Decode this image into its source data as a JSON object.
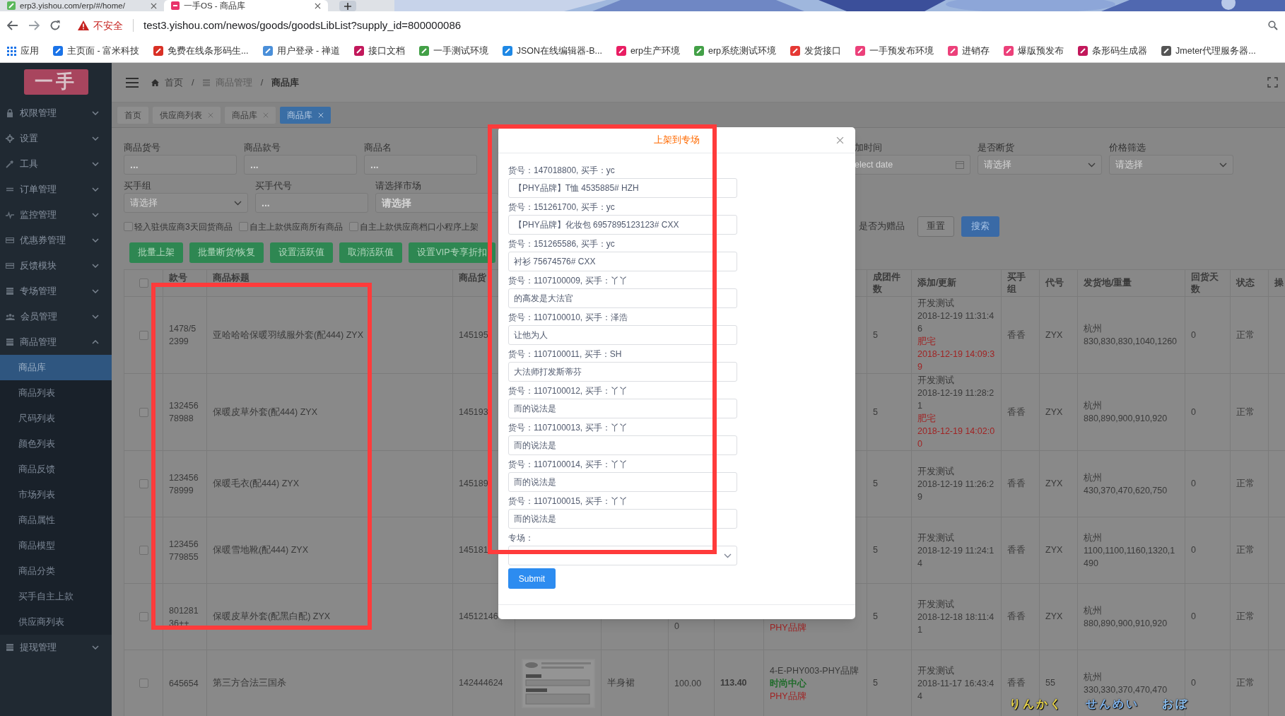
{
  "browser": {
    "tabs": [
      {
        "title": "erp3.yishou.com/erp/#/home/",
        "selected": false
      },
      {
        "title": "一手OS - 商品库",
        "selected": true
      }
    ],
    "security": "不安全",
    "url": "test3.yishou.com/newos/goods/goodsLibList?supply_id=800000086",
    "bookmarks": [
      "应用",
      "主页面 - 富米科技",
      "免费在线条形码生...",
      "用户登录 - 禅道",
      "接口文档",
      "一手测试环境",
      "JSON在线编辑器-B...",
      "erp生产环境",
      "erp系统测试环境",
      "发货接口",
      "一手预发布环境",
      "进销存",
      "爆版预发布",
      "条形码生成器",
      "Jmeter代理服务器..."
    ]
  },
  "sidebar": {
    "logo": "一手",
    "items": [
      {
        "label": "权限管理",
        "expanded": false
      },
      {
        "label": "设置",
        "expanded": false
      },
      {
        "label": "工具",
        "expanded": false
      },
      {
        "label": "订单管理",
        "expanded": false
      },
      {
        "label": "监控管理",
        "expanded": false
      },
      {
        "label": "优惠券管理",
        "expanded": false
      },
      {
        "label": "反馈模块",
        "expanded": false
      },
      {
        "label": "专场管理",
        "expanded": false
      },
      {
        "label": "会员管理",
        "expanded": false
      },
      {
        "label": "商品管理",
        "expanded": true,
        "children": [
          {
            "label": "商品库",
            "selected": true
          },
          {
            "label": "商品列表",
            "selected": false
          },
          {
            "label": "尺码列表",
            "selected": false
          },
          {
            "label": "颜色列表",
            "selected": false
          },
          {
            "label": "商品反馈",
            "selected": false
          },
          {
            "label": "市场列表",
            "selected": false
          },
          {
            "label": "商品属性",
            "selected": false
          },
          {
            "label": "商品模型",
            "selected": false
          },
          {
            "label": "商品分类",
            "selected": false
          },
          {
            "label": "买手自主上款",
            "selected": false
          },
          {
            "label": "供应商列表",
            "selected": false
          }
        ]
      },
      {
        "label": "提现管理",
        "expanded": false
      }
    ]
  },
  "breadcrumb": [
    {
      "kind": "home",
      "label": "首页"
    },
    {
      "kind": "separator",
      "label": "/"
    },
    {
      "kind": "section",
      "label": "商品管理"
    },
    {
      "kind": "separator",
      "label": "/"
    },
    {
      "kind": "current",
      "label": "商品库"
    }
  ],
  "tags": [
    {
      "label": "首页",
      "closable": false,
      "selected": false
    },
    {
      "label": "供应商列表",
      "closable": true,
      "selected": false
    },
    {
      "label": "商品库",
      "closable": true,
      "selected": false
    },
    {
      "label": "商品库",
      "closable": true,
      "selected": true
    }
  ],
  "filters": {
    "row_1_left": [
      {
        "label": "商品货号",
        "kind": "input",
        "placeholder": "..."
      },
      {
        "label": "商品款号",
        "kind": "input",
        "placeholder": "..."
      },
      {
        "label": "商品名",
        "kind": "input",
        "placeholder": "..."
      }
    ],
    "row_1_right": [
      {
        "label": "加时间",
        "kind": "date",
        "placeholder": "elect date"
      },
      {
        "label": "是否断货",
        "kind": "select",
        "placeholder": "请选择"
      },
      {
        "label": "价格筛选",
        "kind": "select",
        "placeholder": "请选择"
      }
    ],
    "row_2": [
      {
        "label": "买手组",
        "kind": "select",
        "placeholder": "请选择"
      },
      {
        "label": "买手代号",
        "kind": "input",
        "placeholder": "..."
      },
      {
        "label": "请选择市场",
        "kind": "input",
        "placeholder": "请选择"
      }
    ],
    "options": [
      {
        "label": "轻入驻供应商3天回货商品",
        "checked": false
      },
      {
        "label": "自主上款供应商所有商品",
        "checked": false
      },
      {
        "label": "自主上款供应商档口小程序上架",
        "checked": false
      }
    ],
    "gift_option": "是否为赠品",
    "reset": "重置",
    "search": "搜索"
  },
  "actions": [
    "批量上架",
    "批量断货/恢复",
    "设置活跃值",
    "取消活跃值",
    "设置VIP专享折扣"
  ],
  "table": {
    "header_checked": false,
    "columns_left": [
      "款号",
      "商品标题",
      "商品货"
    ],
    "columns_right": [
      "成团件数",
      "添加/更新",
      "买手组",
      "代号",
      "发货地/重量",
      "回货天数",
      "状态",
      "操"
    ],
    "rows": [
      {
        "checked": false,
        "style_no": "1478/52399",
        "title": "亚哈哈哈保暖羽绒服外套(配444) ZYX",
        "goods_no": "145195",
        "group_size": "5",
        "creator": "开发测试",
        "created": "2018-12-19 11:31:46",
        "updater": "肥宅",
        "updated": "2018-12-19 14:09:39",
        "buyer_group": "香香",
        "code": "ZYX",
        "origin": "杭州",
        "weights": "830,830,830,1040,1260",
        "return_days": "0",
        "status": "正常"
      },
      {
        "checked": false,
        "style_no": "13245678988",
        "title": "保暖皮草外套(配444) ZYX",
        "goods_no": "145193",
        "group_size": "5",
        "creator": "开发测试",
        "created": "2018-12-19 11:28:21",
        "updater": "肥宅",
        "updated": "2018-12-19 14:02:00",
        "buyer_group": "香香",
        "code": "ZYX",
        "origin": "杭州",
        "weights": "880,890,900,910,920",
        "return_days": "0",
        "status": "正常"
      },
      {
        "checked": false,
        "style_no": "12345678999",
        "title": "保暖毛衣(配444) ZYX",
        "goods_no": "145189",
        "group_size": "5",
        "creator": "开发测试",
        "created": "2018-12-19 11:26:29",
        "buyer_group": "香香",
        "code": "ZYX",
        "origin": "杭州",
        "weights": "430,370,470,620,750",
        "return_days": "0",
        "status": "正常"
      },
      {
        "checked": false,
        "style_no": "123456779855",
        "title": "保暖雪地靴(配444) ZYX",
        "goods_no": "145181",
        "group_size": "5",
        "creator": "开发测试",
        "created": "2018-12-19 11:24:14",
        "buyer_group": "香香",
        "code": "ZYX",
        "origin": "杭州",
        "weights": "1100,1100,1160,1320,1490",
        "return_days": "0",
        "status": "正常"
      },
      {
        "checked": false,
        "style_no": "80128136++",
        "title": "保暖皮草外套(配黑白配) ZYX",
        "goods_no": "14512146",
        "price": "0",
        "tags": [
          {
            "kind": "brand",
            "text": "PHY品牌"
          }
        ],
        "group_size": "5",
        "creator": "开发测试",
        "created": "2018-12-18 18:11:41",
        "buyer_group": "香香",
        "code": "ZYX",
        "origin": "杭州",
        "weights": "880,890,900,910,920",
        "return_days": "0",
        "status": "正常"
      },
      {
        "checked": false,
        "style_no": "645654",
        "title": "第三方合法三国杀",
        "goods_no": "142444624",
        "image": {
          "kind": "picture"
        },
        "category": "半身裙",
        "price": "100.00",
        "price_2": "113.40",
        "tags": [
          {
            "kind": "code",
            "text": "4-E-PHY003-PHY品牌"
          },
          {
            "kind": "center",
            "text": "时尚中心"
          },
          {
            "kind": "brand",
            "text": "PHY品牌"
          }
        ],
        "group_size": "5",
        "creator": "开发测试",
        "created": "2018-11-17 16:43:44",
        "buyer_group": "香香",
        "code": "55",
        "origin": "杭州",
        "weights": "330,330,370,470,470",
        "return_days": "0",
        "status": "正常"
      }
    ]
  },
  "dialog": {
    "title": "上架到专场",
    "items": [
      {
        "label": "货号：147018800, 买手：yc",
        "value": "【PHY品牌】T恤 4535885# HZH"
      },
      {
        "label": "货号：151261700, 买手：yc",
        "value": "【PHY品牌】化妆包 6957895123123# CXX"
      },
      {
        "label": "货号：151265586, 买手：yc",
        "value": "衬衫 75674576# CXX"
      },
      {
        "label": "货号：1107100009, 买手：丫丫",
        "value": "的高发是大法官"
      },
      {
        "label": "货号：1107100010, 买手：泽浩",
        "value": "让他为人"
      },
      {
        "label": "货号：1107100011, 买手：SH",
        "value": "大法师打发斯蒂芬"
      },
      {
        "label": "货号：1107100012, 买手：丫丫",
        "value": "而的说法是"
      },
      {
        "label": "货号：1107100013, 买手：丫丫",
        "value": "而的说法是"
      },
      {
        "label": "货号：1107100014, 买手：丫丫",
        "value": "而的说法是"
      },
      {
        "label": "货号：1107100015, 买手：丫丫",
        "value": "而的说法是"
      }
    ],
    "topic_label": "专场：",
    "submit": "Submit"
  },
  "captions": [
    {
      "text": "りんかく",
      "color": "#e8d44a"
    },
    {
      "text": "せんめい",
      "color": "#7fb2ea"
    },
    {
      "text": "おぼ",
      "color": "#8ec4f7"
    }
  ]
}
